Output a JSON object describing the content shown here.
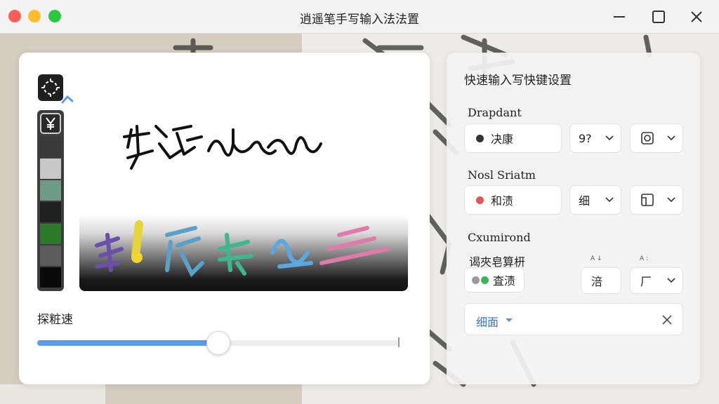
{
  "window": {
    "title": "逍遥笔手写输入法法置"
  },
  "left": {
    "handwriting_sample": "步谠加加",
    "palette_colors": [
      "#3a3a3a",
      "#c8c8c8",
      "#6e9a88",
      "#202020",
      "#2a7a2a",
      "#5c5c5c",
      "#0a0a0a"
    ],
    "speed_label": "探粧速",
    "speed_value": 0.5
  },
  "right": {
    "title": "快速输入写快键设置",
    "section1": {
      "label": "Drapdant",
      "main_value": "决康",
      "dot_color": "#333333",
      "opt_a": "9?",
      "opt_b_icon": "square-target-icon"
    },
    "section2": {
      "label": "Nosl Sriatm",
      "main_value": "和渍",
      "dot_color": "#e05656",
      "opt_a": "细",
      "opt_b_icon": "panel-icon"
    },
    "section3": {
      "label": "Cxumirond",
      "sub_label": "谒夾皂算枅",
      "main_value": "査渍",
      "opt_a": "涪",
      "opt_b": "厂",
      "tick_a": "A ↓",
      "tick_b": "A :"
    },
    "search": {
      "value": "细面"
    }
  }
}
